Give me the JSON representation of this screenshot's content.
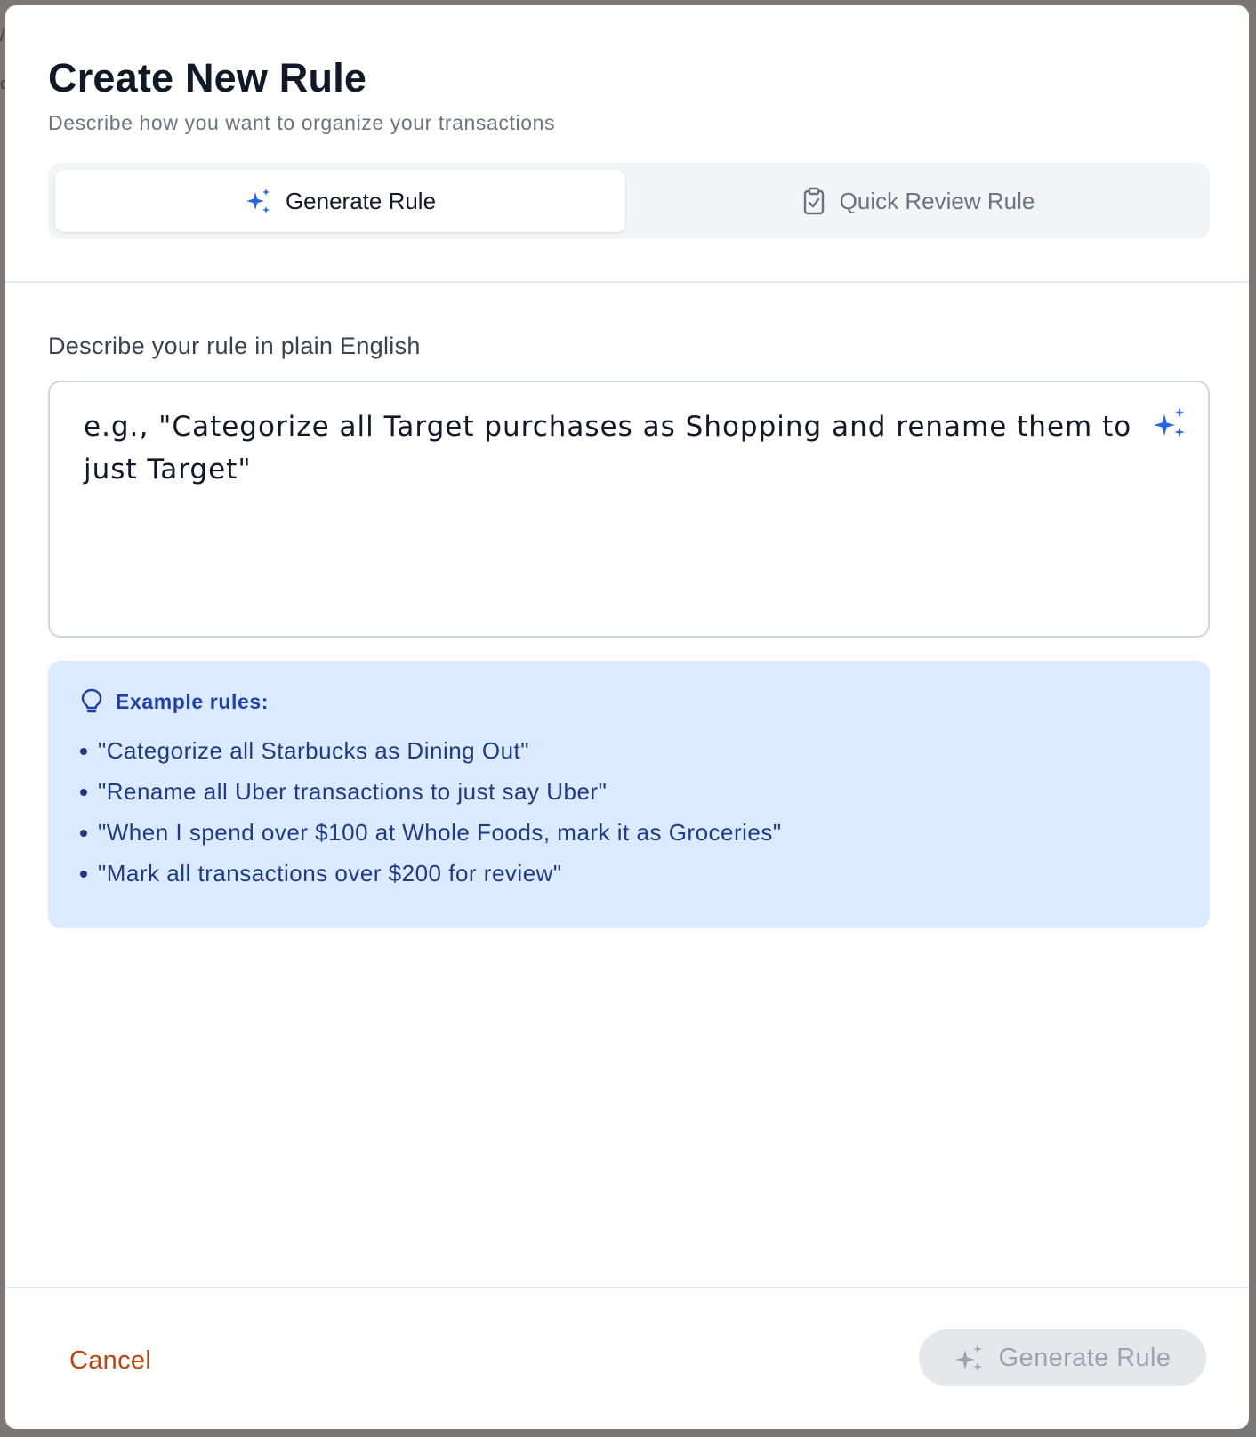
{
  "dialog": {
    "title": "Create New Rule",
    "subtitle": "Describe how you want to organize your transactions"
  },
  "tabs": [
    {
      "label": "Generate Rule",
      "icon": "sparkles-icon",
      "active": true
    },
    {
      "label": "Quick Review Rule",
      "icon": "clipboard-check-icon",
      "active": false
    }
  ],
  "form": {
    "field_label": "Describe your rule in plain English",
    "textarea_value": "",
    "textarea_placeholder": "e.g., \"Categorize all Target purchases as Shopping and rename them to just Target\""
  },
  "examples": {
    "heading": "Example rules:",
    "icon": "lightbulb-icon",
    "items": [
      "\"Categorize all Starbucks as Dining Out\"",
      "\"Rename all Uber transactions to just say Uber\"",
      "\"When I spend over $100 at Whole Foods, mark it as Groceries\"",
      "\"Mark all transactions over $200 for review\""
    ]
  },
  "footer": {
    "cancel_label": "Cancel",
    "primary_label": "Generate Rule",
    "primary_disabled": true
  },
  "colors": {
    "accent_blue": "#2563eb",
    "cancel_orange": "#c2410c",
    "examples_bg": "#dbeafe",
    "examples_text": "#1e3a8a"
  }
}
